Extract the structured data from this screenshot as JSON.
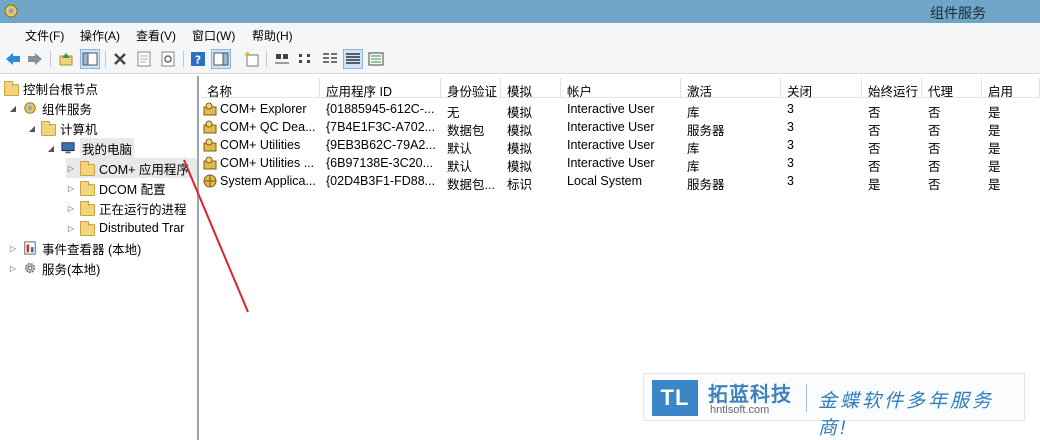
{
  "window": {
    "title": "组件服务"
  },
  "menu": {
    "items": [
      "文件(F)",
      "操作(A)",
      "查看(V)",
      "窗口(W)",
      "帮助(H)"
    ]
  },
  "tree": {
    "root": "控制台根节点",
    "component_services": "组件服务",
    "computers": "计算机",
    "my_computer": "我的电脑",
    "com_apps": "COM+ 应用程序",
    "dcom": "DCOM 配置",
    "running": "正在运行的进程",
    "dtc": "Distributed Trar",
    "event_viewer": "事件查看器 (本地)",
    "services": "服务(本地)"
  },
  "table": {
    "headers": [
      "名称",
      "应用程序 ID",
      "身份验证",
      "模拟",
      "帐户",
      "激活",
      "关闭",
      "始终运行",
      "代理",
      "启用"
    ],
    "rows": [
      [
        "COM+ Explorer",
        "{01885945-612C-...",
        "无",
        "模拟",
        "Interactive User",
        "库",
        "3",
        "否",
        "否",
        "是"
      ],
      [
        "COM+ QC Dea...",
        "{7B4E1F3C-A702...",
        "数据包",
        "模拟",
        "Interactive User",
        "服务器",
        "3",
        "否",
        "否",
        "是"
      ],
      [
        "COM+ Utilities",
        "{9EB3B62C-79A2...",
        "默认",
        "模拟",
        "Interactive User",
        "库",
        "3",
        "否",
        "否",
        "是"
      ],
      [
        "COM+ Utilities ...",
        "{6B97138E-3C20...",
        "默认",
        "模拟",
        "Interactive User",
        "库",
        "3",
        "否",
        "否",
        "是"
      ],
      [
        "System Applica...",
        "{02D4B3F1-FD88...",
        "数据包...",
        "标识",
        "Local System",
        "服务器",
        "3",
        "是",
        "否",
        "是"
      ]
    ]
  },
  "watermark": {
    "logo": "TL",
    "name": "拓蓝科技",
    "url": "hntlsoft.com",
    "slogan": "金蝶软件多年服务商!"
  },
  "colors": {
    "titlebar": "#6fa6c7",
    "annotation": "#d9232d",
    "brand": "#3b86c6"
  }
}
